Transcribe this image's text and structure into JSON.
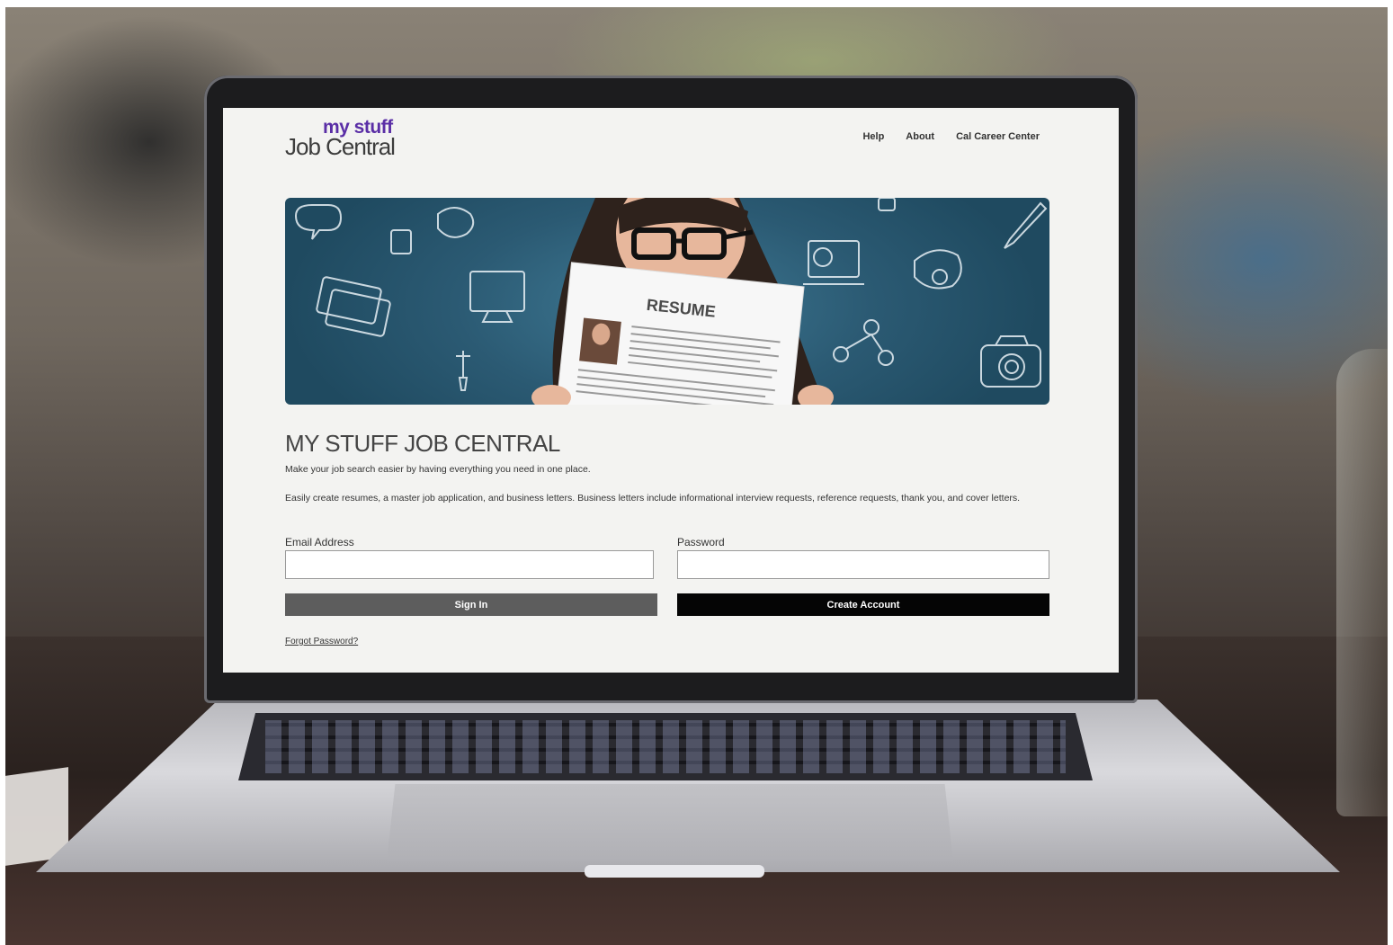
{
  "logo": {
    "top": "my stuff",
    "bottom": "Job Central",
    "accent_color": "#5a2ea6"
  },
  "nav": {
    "items": [
      {
        "label": "Help"
      },
      {
        "label": "About"
      },
      {
        "label": "Cal Career Center"
      }
    ]
  },
  "hero": {
    "image": "woman-holding-resume",
    "document_heading": "RESUME",
    "background_color": "#2b5a73"
  },
  "main": {
    "title": "MY STUFF JOB CENTRAL",
    "intro": "Make your job search easier by having everything you need in one place.",
    "description": "Easily create resumes, a master job application, and business letters. Business letters include informational interview requests, reference requests, thank you, and cover letters."
  },
  "form": {
    "email_label": "Email Address",
    "email_value": "",
    "password_label": "Password",
    "password_value": "",
    "signin_label": "Sign In",
    "create_label": "Create Account",
    "forgot_label": "Forgot Password?",
    "signin_color": "#5d5d5d",
    "create_color": "#050505"
  }
}
